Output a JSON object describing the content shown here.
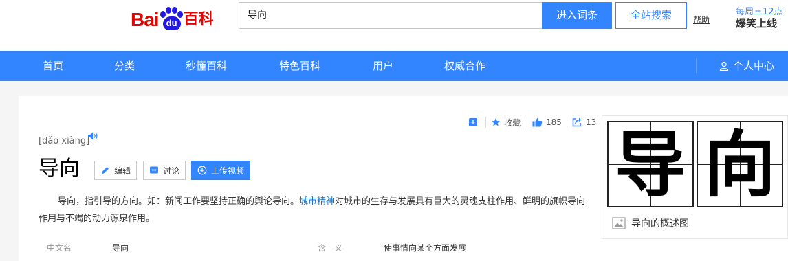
{
  "header": {
    "logo_bai": "Bai",
    "logo_du": "du",
    "logo_baike": "百科",
    "search_value": "导向",
    "enter_button": "进入词条",
    "all_search_button": "全站搜索",
    "help_link": "帮助",
    "promo_line1": "每周三12点",
    "promo_line2": "爆笑上线"
  },
  "nav": {
    "items": [
      "首页",
      "分类",
      "秒懂百科",
      "特色百科",
      "用户",
      "权威合作"
    ],
    "user_center": "个人中心"
  },
  "entry": {
    "pinyin": "[dǎo xiàng]",
    "title": "导向",
    "edit_button": "编辑",
    "discuss_button": "讨论",
    "upload_video_button": "上传视频",
    "collect_label": "收藏",
    "like_count": "185",
    "share_count": "13",
    "para_before_link": "导向，指引导的方向。如：新闻工作要坚持正确的舆论导向。",
    "para_link": "城市精神",
    "para_after_link": "对城市的生存与发展具有巨大的灵魂支柱作用、鲜明的旗帜导向作用与不竭的动力源泉作用。",
    "info_label_1": "中文名",
    "info_value_1": "导向",
    "info_label_2": "含　义",
    "info_value_2": "使事情向某个方面发展"
  },
  "sidebar": {
    "char_1": "导",
    "char_2": "向",
    "caption": "导向的概述图"
  },
  "colors": {
    "brand_blue": "#3385ff",
    "logo_red": "#e10601",
    "logo_blue": "#2319dc",
    "link_blue": "#136ec2"
  }
}
